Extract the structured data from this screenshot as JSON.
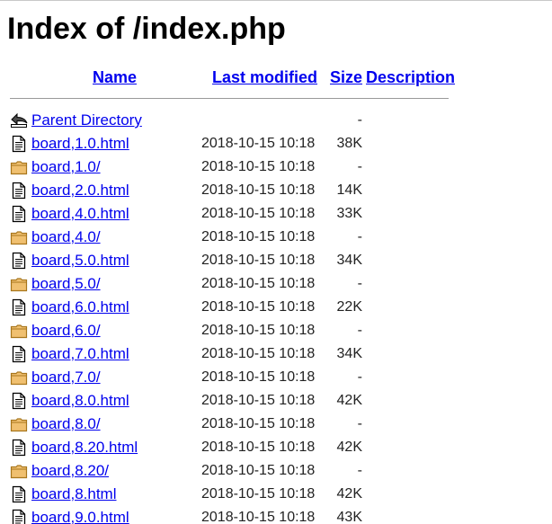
{
  "page": {
    "title": "Index of /index.php"
  },
  "columns": {
    "name": "Name",
    "last_modified": "Last modified",
    "size": "Size",
    "description": "Description"
  },
  "entries": [
    {
      "icon": "back-icon",
      "name": "Parent Directory",
      "modified": "",
      "size": "-",
      "description": ""
    },
    {
      "icon": "file-icon",
      "name": "board,1.0.html",
      "modified": "2018-10-15 10:18",
      "size": "38K",
      "description": ""
    },
    {
      "icon": "folder-icon",
      "name": "board,1.0/",
      "modified": "2018-10-15 10:18",
      "size": "-",
      "description": ""
    },
    {
      "icon": "file-icon",
      "name": "board,2.0.html",
      "modified": "2018-10-15 10:18",
      "size": "14K",
      "description": ""
    },
    {
      "icon": "file-icon",
      "name": "board,4.0.html",
      "modified": "2018-10-15 10:18",
      "size": "33K",
      "description": ""
    },
    {
      "icon": "folder-icon",
      "name": "board,4.0/",
      "modified": "2018-10-15 10:18",
      "size": "-",
      "description": ""
    },
    {
      "icon": "file-icon",
      "name": "board,5.0.html",
      "modified": "2018-10-15 10:18",
      "size": "34K",
      "description": ""
    },
    {
      "icon": "folder-icon",
      "name": "board,5.0/",
      "modified": "2018-10-15 10:18",
      "size": "-",
      "description": ""
    },
    {
      "icon": "file-icon",
      "name": "board,6.0.html",
      "modified": "2018-10-15 10:18",
      "size": "22K",
      "description": ""
    },
    {
      "icon": "folder-icon",
      "name": "board,6.0/",
      "modified": "2018-10-15 10:18",
      "size": "-",
      "description": ""
    },
    {
      "icon": "file-icon",
      "name": "board,7.0.html",
      "modified": "2018-10-15 10:18",
      "size": "34K",
      "description": ""
    },
    {
      "icon": "folder-icon",
      "name": "board,7.0/",
      "modified": "2018-10-15 10:18",
      "size": "-",
      "description": ""
    },
    {
      "icon": "file-icon",
      "name": "board,8.0.html",
      "modified": "2018-10-15 10:18",
      "size": "42K",
      "description": ""
    },
    {
      "icon": "folder-icon",
      "name": "board,8.0/",
      "modified": "2018-10-15 10:18",
      "size": "-",
      "description": ""
    },
    {
      "icon": "file-icon",
      "name": "board,8.20.html",
      "modified": "2018-10-15 10:18",
      "size": "42K",
      "description": ""
    },
    {
      "icon": "folder-icon",
      "name": "board,8.20/",
      "modified": "2018-10-15 10:18",
      "size": "-",
      "description": ""
    },
    {
      "icon": "file-icon",
      "name": "board,8.html",
      "modified": "2018-10-15 10:18",
      "size": "42K",
      "description": ""
    },
    {
      "icon": "file-icon",
      "name": "board,9.0.html",
      "modified": "2018-10-15 10:18",
      "size": "43K",
      "description": ""
    }
  ],
  "colors": {
    "link": "#0000ee",
    "text": "#222222",
    "folder_fill": "#f0c070",
    "folder_stroke": "#a8761c",
    "rule": "#9a9a9a"
  }
}
